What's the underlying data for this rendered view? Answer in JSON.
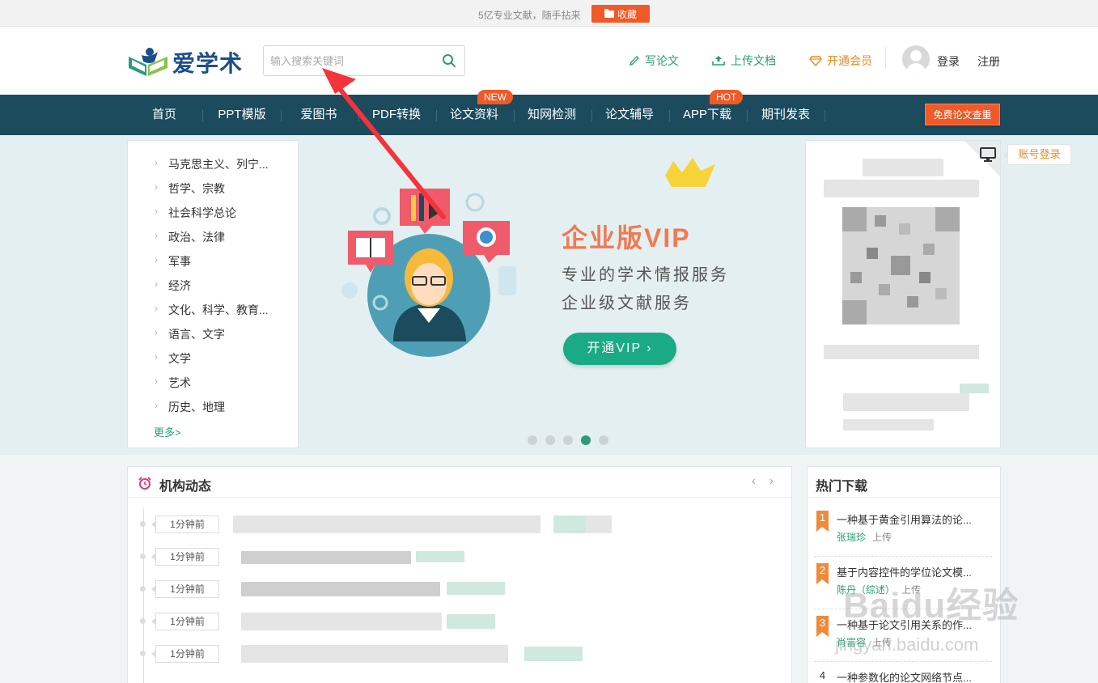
{
  "topbar": {
    "notice": "5亿专业文献，随手拈来",
    "fav_label": "收藏"
  },
  "header": {
    "logo_text": "爱学术",
    "search_placeholder": "输入搜索关键词",
    "write_label": "写论文",
    "upload_label": "上传文档",
    "vip_label": "开通会员",
    "login_label": "登录",
    "register_label": "注册"
  },
  "nav": {
    "items": [
      "首页",
      "PPT模版",
      "爱图书",
      "PDF转换",
      "论文资料",
      "知网检测",
      "论文辅导",
      "APP下载",
      "期刊发表"
    ],
    "badge_new": "NEW",
    "badge_hot": "HOT",
    "cta": "免费论文查重"
  },
  "categories": {
    "items": [
      "马克思主义、列宁...",
      "哲学、宗教",
      "社会科学总论",
      "政治、法律",
      "军事",
      "经济",
      "文化、科学、教育...",
      "语言、文字",
      "文学",
      "艺术",
      "历史、地理"
    ],
    "more": "更多>"
  },
  "banner": {
    "title": "企业版VIP",
    "line1": "专业的学术情报服务",
    "line2": "企业级文献服务",
    "button": "开通VIP ›",
    "active_slide": 4,
    "slide_count": 5
  },
  "qr_panel": {
    "account_login": "账号登录"
  },
  "org_updates": {
    "title": "机构动态",
    "pager": "‹ ›",
    "time_labels": [
      "1分钟前",
      "1分钟前",
      "1分钟前",
      "1分钟前",
      "1分钟前"
    ]
  },
  "hot_downloads": {
    "title": "热门下载",
    "items": [
      {
        "rank": "1",
        "title": "一种基于黄金引用算法的论...",
        "author": "张瑞珍",
        "action": "上传"
      },
      {
        "rank": "2",
        "title": "基于内容控件的学位论文模...",
        "author": "陈丹（综述）",
        "action": "上传"
      },
      {
        "rank": "3",
        "title": "一种基于论文引用关系的作...",
        "author": "肖富容",
        "action": "上传"
      },
      {
        "rank": "4",
        "title": "一种参数化的论文网络节点...",
        "author": "",
        "action": ""
      }
    ]
  },
  "watermark": {
    "text": "Baidu经验",
    "sub": "jingyan.baidu.com"
  },
  "colors": {
    "nav_bg": "#1c4b5e",
    "accent_orange": "#f05a28",
    "accent_green": "#2a9d76",
    "hero_bg": "#e4eff2"
  }
}
